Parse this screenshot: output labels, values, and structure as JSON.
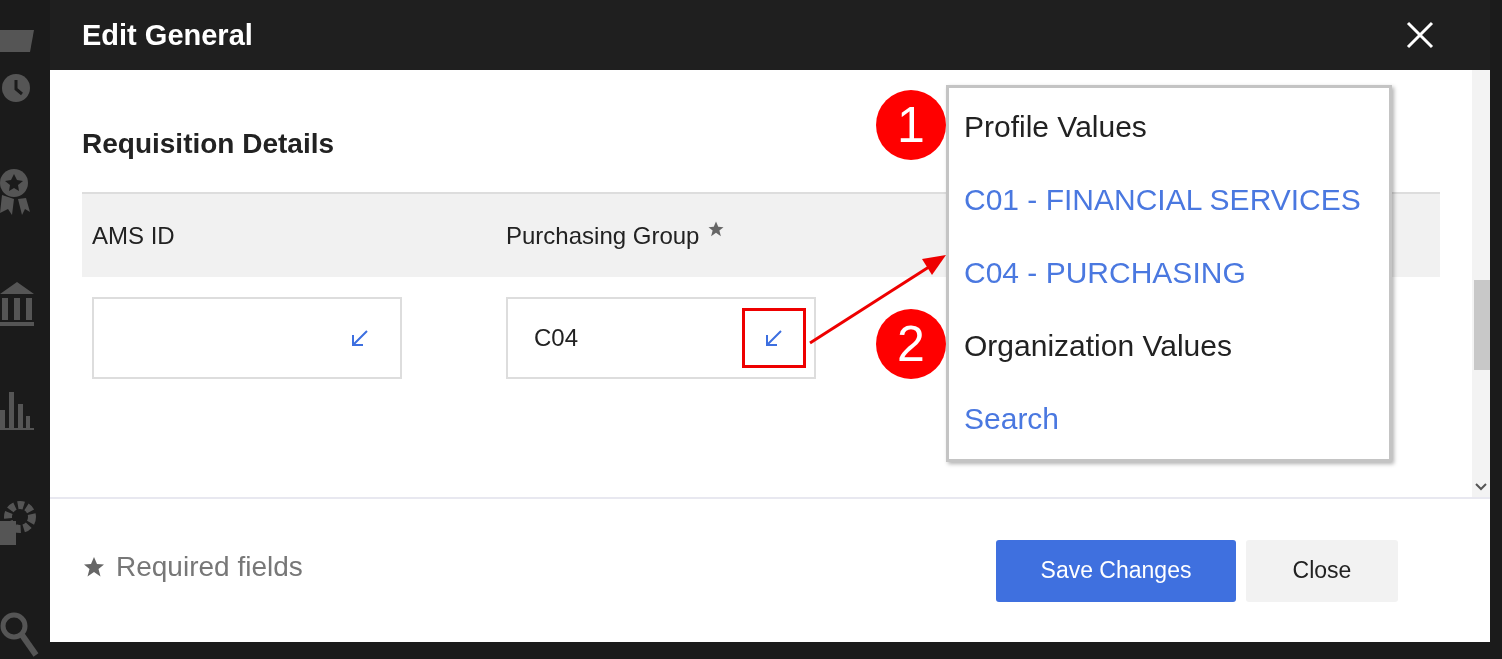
{
  "dialog": {
    "title": "Edit General",
    "section_title": "Requisition Details",
    "fields": [
      {
        "label": "AMS ID",
        "required": false,
        "highlighted": false
      },
      {
        "label": "Purchasing Group",
        "required": true,
        "value": "C04",
        "highlighted": true
      }
    ],
    "required_note": "Required fields",
    "buttons": [
      {
        "label": "Save Changes",
        "kind": "primary"
      },
      {
        "label": "Close",
        "kind": "secondary"
      }
    ]
  },
  "dropdown": {
    "items": [
      {
        "kind": "header",
        "label": "Profile Values",
        "callout": "1"
      },
      {
        "kind": "option",
        "label": "C01 - FINANCIAL SERVICES"
      },
      {
        "kind": "option",
        "label": "C04 - PURCHASING"
      },
      {
        "kind": "header",
        "label": "Organization Values",
        "callout": "2"
      },
      {
        "kind": "option",
        "label": "Search"
      }
    ]
  }
}
